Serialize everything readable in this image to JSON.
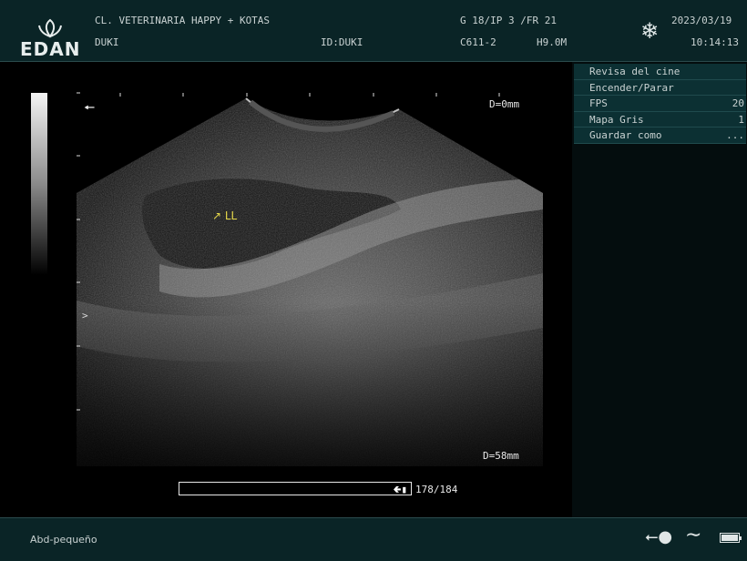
{
  "header": {
    "brand": "EDAN",
    "clinic": "CL. VETERINARIA HAPPY + KOTAS",
    "patient_name": "DUKI",
    "patient_id": "ID:DUKI",
    "params": "G 18/IP 3 /FR 21",
    "probe": "C611-2",
    "frequency": "H9.0M",
    "date": "2023/03/19",
    "time": "10:14:13",
    "freeze_icon": "snowflake-icon"
  },
  "image": {
    "depth_top": "D=0mm",
    "depth_bottom": "D=58mm",
    "annotation": "↗ LL",
    "focus_marker": ">",
    "back_arrow": "🠔"
  },
  "cine": {
    "counter": "178/184",
    "position_fraction": 0.967
  },
  "menu": {
    "items": [
      {
        "label": "Revisa del cine",
        "value": ""
      },
      {
        "label": "Encender/Parar",
        "value": ""
      },
      {
        "label": "FPS",
        "value": "20"
      },
      {
        "label": "Mapa Gris",
        "value": "1"
      },
      {
        "label": "Guardar como",
        "value": "..."
      }
    ]
  },
  "footer": {
    "preset": "Abd-pequeño",
    "usb_icon": "usb-icon",
    "wave_icon": "wave-icon",
    "battery_icon": "battery-icon"
  },
  "colors": {
    "bar_bg": "#0a2426",
    "menu_bg": "#0c3033",
    "annotation": "#e6d84a"
  }
}
